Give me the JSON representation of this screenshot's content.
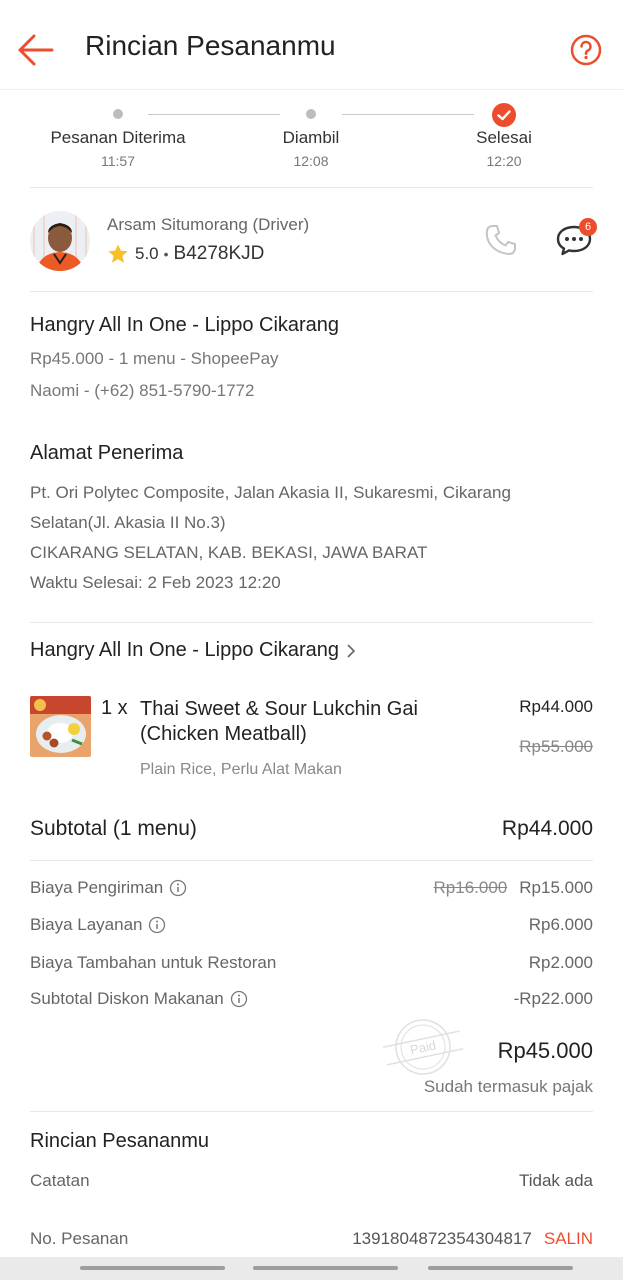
{
  "header": {
    "title": "Rincian Pesananmu",
    "back_icon": "arrow-left-icon",
    "help_icon": "question-circle-icon",
    "accent": "#ee4d2d"
  },
  "timeline": {
    "steps": [
      {
        "label": "Pesanan Diterima",
        "time": "11:57",
        "state": "done"
      },
      {
        "label": "Diambil",
        "time": "12:08",
        "state": "done"
      },
      {
        "label": "Selesai",
        "time": "12:20",
        "state": "current"
      }
    ]
  },
  "driver": {
    "name": "Arsam Situmorang (Driver)",
    "rating": "5.0",
    "separator": "•",
    "plate": "B4278KJD",
    "chat_badge": "6"
  },
  "restaurant": {
    "name": "Hangry All In One - Lippo Cikarang",
    "summary": "Rp45.000 - 1 menu  - ShopeePay",
    "contact": "Naomi - (+62) 851-5790-1772"
  },
  "address": {
    "title": "Alamat Penerima",
    "line1": "Pt. Ori Polytec Composite, Jalan Akasia II, Sukaresmi, Cikarang",
    "line2": "Selatan(Jl. Akasia II No.3)",
    "line3": "CIKARANG SELATAN, KAB. BEKASI, JAWA BARAT",
    "line4": "Waktu Selesai: 2 Feb 2023 12:20"
  },
  "store_link": "Hangry All In One - Lippo Cikarang",
  "item": {
    "qty": "1 x",
    "name": "Thai Sweet & Sour Lukchin Gai (Chicken Meatball)",
    "price": "Rp44.000",
    "original_price": "Rp55.000",
    "options": "Plain Rice, Perlu Alat Makan"
  },
  "subtotal": {
    "label": "Subtotal (1 menu)",
    "value": "Rp44.000"
  },
  "fees": {
    "delivery": {
      "label": "Biaya Pengiriman",
      "original": "Rp16.000",
      "value": "Rp15.000"
    },
    "service": {
      "label": "Biaya Layanan",
      "value": "Rp6.000"
    },
    "restaurant": {
      "label": "Biaya Tambahan untuk Restoran",
      "value": "Rp2.000"
    },
    "discount": {
      "label": "Subtotal Diskon Makanan",
      "value": "-Rp22.000"
    }
  },
  "total": {
    "stamp": "Paid",
    "value": "Rp45.000",
    "note": "Sudah termasuk pajak"
  },
  "details": {
    "title": "Rincian Pesananmu",
    "notes_label": "Catatan",
    "notes_value": "Tidak ada",
    "order_label": "No. Pesanan",
    "order_value": "1391804872354304817",
    "copy_label": "SALIN"
  }
}
